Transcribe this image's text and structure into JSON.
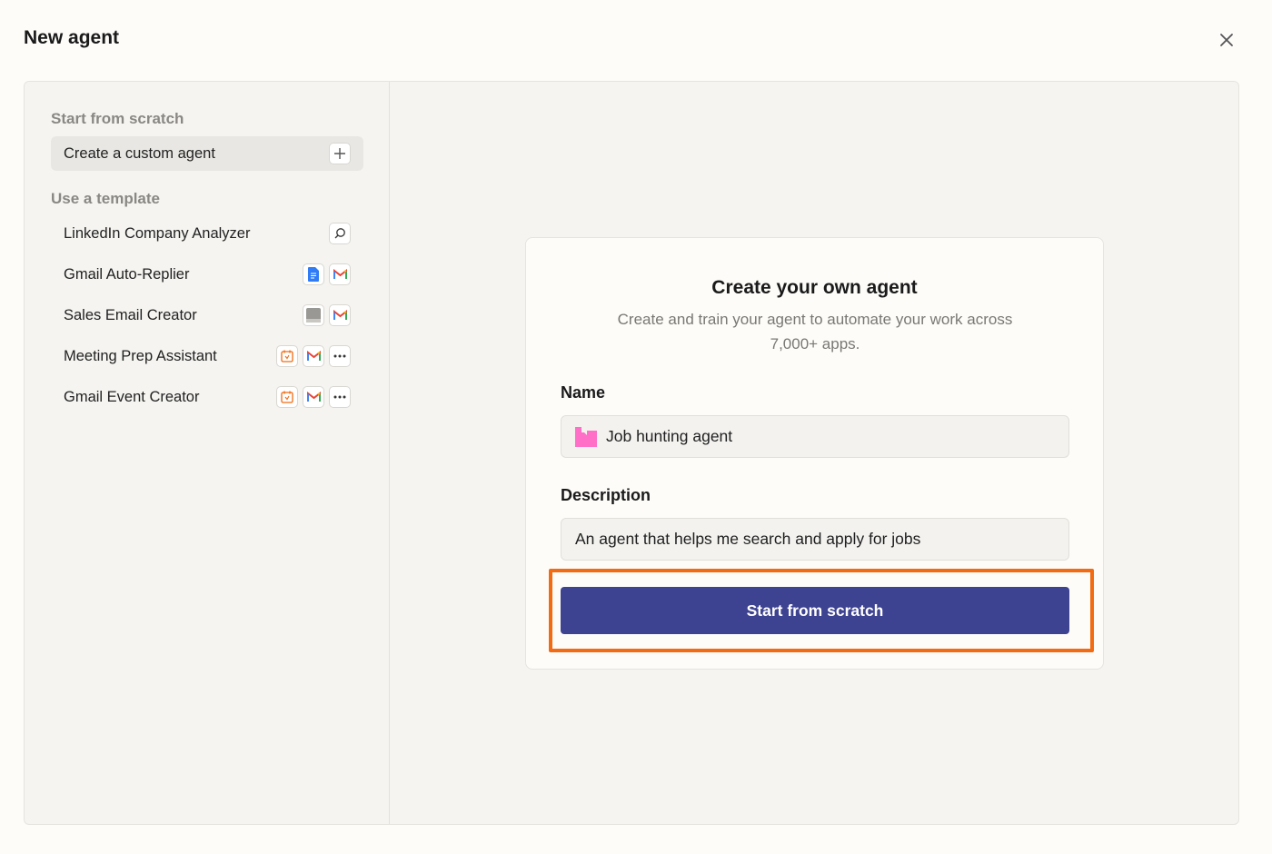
{
  "dialog": {
    "title": "New agent"
  },
  "sidebar": {
    "scratch_section_label": "Start from scratch",
    "custom_agent_label": "Create a custom agent",
    "template_section_label": "Use a template",
    "templates": [
      {
        "label": "LinkedIn Company Analyzer",
        "icons": [
          "search-icon"
        ]
      },
      {
        "label": "Gmail Auto-Replier",
        "icons": [
          "google-docs-icon",
          "gmail-icon"
        ]
      },
      {
        "label": "Sales Email Creator",
        "icons": [
          "zapier-tables-icon",
          "gmail-icon"
        ]
      },
      {
        "label": "Meeting Prep Assistant",
        "icons": [
          "calendar-icon",
          "gmail-icon",
          "more-icon"
        ]
      },
      {
        "label": "Gmail Event Creator",
        "icons": [
          "calendar-icon",
          "gmail-icon",
          "more-icon"
        ]
      }
    ]
  },
  "card": {
    "title": "Create your own agent",
    "subtitle": "Create and train your agent to automate your work across 7,000+ apps.",
    "name_label": "Name",
    "name_value": "Job hunting agent",
    "description_label": "Description",
    "description_value": "An agent that helps me search and apply for jobs",
    "start_button_label": "Start from scratch"
  },
  "colors": {
    "primary_button": "#3d4291",
    "highlight_border": "#f26a12",
    "agent_icon": "#ff6ec7"
  }
}
